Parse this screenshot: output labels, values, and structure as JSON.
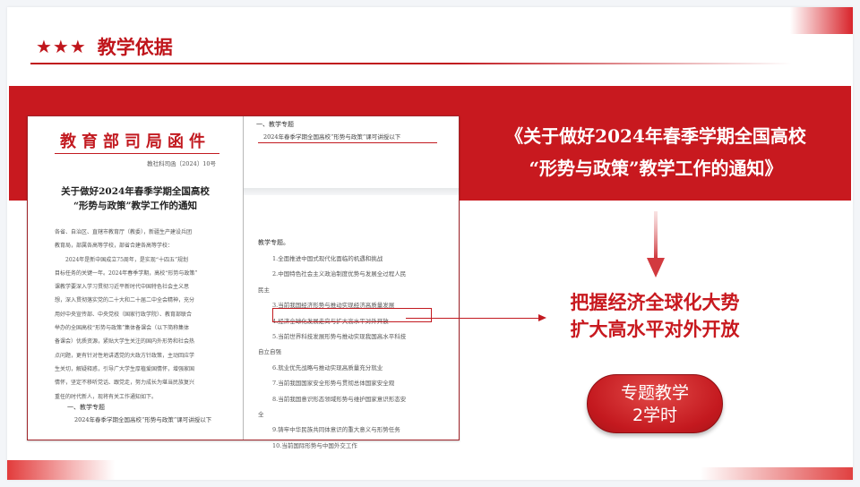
{
  "header": {
    "stars": "★★★",
    "title": "教学依据"
  },
  "notice": {
    "line1": "《关于做好2024年春季学期全国高校",
    "line2": "“形势与政策”教学工作的通知》"
  },
  "doc_left": {
    "letterhead": "教育部司局函件",
    "number": "教社科司函〔2024〕10号",
    "title_line1": "关于做好2024年春季学期全国高校",
    "title_line2": "“形势与政策”教学工作的通知",
    "body": [
      "各省、自治区、直辖市教育厅（教委），新疆生产建设兵团",
      "教育局，部属各高等学校，部省合建各高等学校：",
      "　　2024年是新中国成立75周年，是实现“十四五”规划",
      "目标任务的关键一年。2024年春季学期，高校“形势与政策”",
      "课教学要深入学习贯彻习近平新时代中国特色社会主义思",
      "想，深入贯彻落实党的二十大和二十届二中全会精神，充分",
      "用好中央宣传部、中央党校（国家行政学院）、教育部联合",
      "举办的全国高校“形势与政策”集体备课会（以下简称集体",
      "备课会）优质资源，紧贴大学生关注的国内外形势和社会热",
      "点问题，更有针对性地讲透党的大政方针政策，主动回应学",
      "生关切，解疑释惑，引导广大学生厚植爱国情怀，增强家国",
      "情怀，坚定不移听党话、跟党走，努力成长为堪当民族复兴",
      "重任的时代新人，现将有关工作通知如下。"
    ],
    "section": "一、教学专题",
    "ref": "2024年春季学期全国高校“形势与政策”课可讲授以下"
  },
  "doc_right": {
    "section": "一、教学专题",
    "ref": "2024年春季学期全国高校“形势与政策”课可讲授以下",
    "heading": "教学专题。",
    "topics": [
      "1.全面推进中国式现代化面临的机遇和挑战",
      "2.中国特色社会主义政治制度优势与发展全过程人民",
      "民主",
      "3.当前我国经济形势与推动实现经济高质量发展",
      "4.经济全球化发展走向与扩大高水平对外开放",
      "5.当前世界科技发展形势与推动实现我国高水平科技",
      "自立自强",
      "6.就业优先战略与推动实现高质量充分就业",
      "7.当前我国国家安全形势与贯彻总体国家安全观",
      "8.当前我国意识形态领域形势与维护国家意识形态安",
      "全",
      "9.铸牢中华民族共同体意识的重大意义与形势任务",
      "10.当前国际形势与中国外交工作"
    ]
  },
  "conclusion": {
    "line1": "把握经济全球化大势",
    "line2": "扩大高水平对外开放"
  },
  "badge": {
    "line1": "专题教学",
    "line2": "2学时"
  },
  "colors": {
    "accent": "#c8191f",
    "band": "#c8191f",
    "text_white": "#ffffff"
  }
}
